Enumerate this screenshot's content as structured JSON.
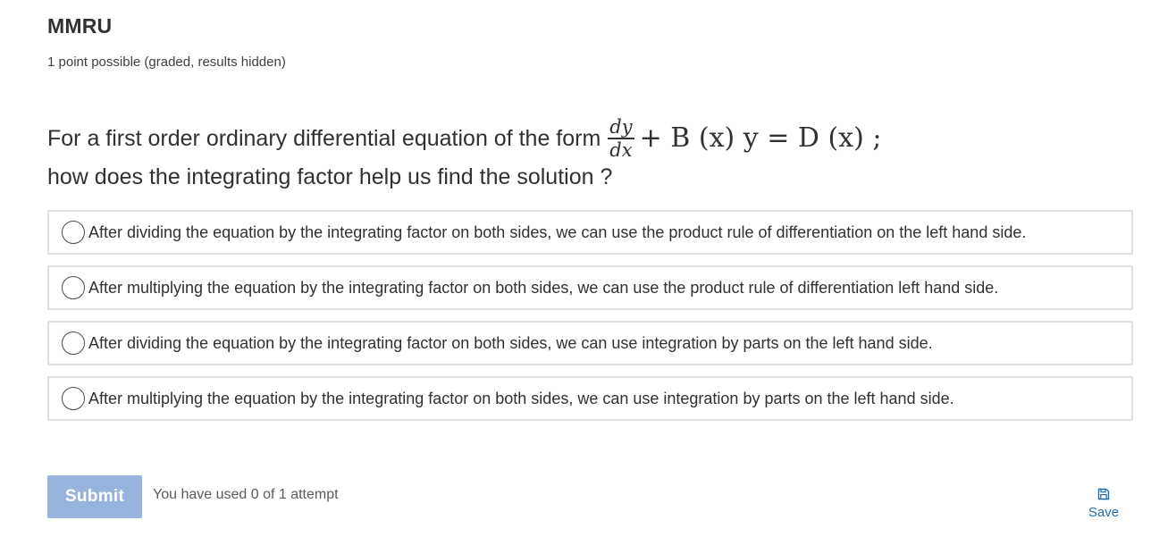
{
  "problem": {
    "title": "MMRU",
    "points": "1 point possible (graded, results hidden)"
  },
  "question": {
    "line1": "For a first order ordinary differential equation of the form",
    "equation": {
      "frac_num": "dy",
      "frac_den": "dx",
      "rest": "+ B (x) y = D (x) ;"
    },
    "line2": "how does the integrating factor help us find the solution ?"
  },
  "choices": [
    {
      "label": "After dividing the equation by the integrating factor on both sides, we can use the product rule of differentiation on the left hand side.",
      "selected": false
    },
    {
      "label": "After multiplying the equation by the integrating factor on both sides, we can use the product rule of differentiation left hand side.",
      "selected": false
    },
    {
      "label": "After dividing the equation by the integrating factor on both sides, we can use integration by parts on the left hand side.",
      "selected": false
    },
    {
      "label": "After multiplying the equation by the integrating factor on both sides, we can use integration by parts on the left hand side.",
      "selected": false
    }
  ],
  "actions": {
    "submit_label": "Submit",
    "attempts_text": "You have used 0 of 1 attempt",
    "save_label": "Save",
    "save_icon": "floppy-disk-icon"
  },
  "colors": {
    "submit_bg": "#98b3dd",
    "link": "#1f6fb2",
    "border": "#e0e0e0"
  }
}
